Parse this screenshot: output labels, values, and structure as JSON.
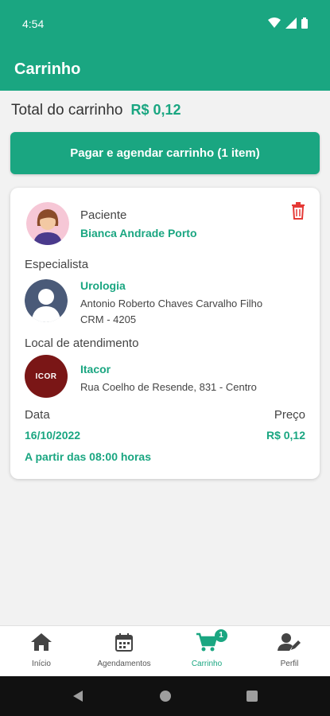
{
  "status_bar": {
    "time": "4:54"
  },
  "app_bar": {
    "title": "Carrinho"
  },
  "summary": {
    "label": "Total do carrinho",
    "value": "R$ 0,12"
  },
  "pay_button": {
    "label": "Pagar e agendar carrinho (1 item)"
  },
  "cart_item": {
    "patient_label": "Paciente",
    "patient_name": "Bianca Andrade Porto",
    "specialist_label": "Especialista",
    "specialty": "Urologia",
    "doctor_name": "Antonio Roberto Chaves Carvalho Filho",
    "doctor_crm": "CRM - 4205",
    "location_label": "Local de atendimento",
    "clinic_name": "Itacor",
    "clinic_address": "Rua Coelho de Resende, 831 - Centro",
    "date_label": "Data",
    "price_label": "Preço",
    "date": "16/10/2022",
    "price": "R$ 0,12",
    "time_note": "A partir das 08:00 horas",
    "clinic_logo_text": "ICOR"
  },
  "bottom_nav": {
    "items": [
      {
        "label": "Início",
        "icon": "home-icon"
      },
      {
        "label": "Agendamentos",
        "icon": "calendar-icon"
      },
      {
        "label": "Carrinho",
        "icon": "cart-icon",
        "badge": "1",
        "active": true
      },
      {
        "label": "Perfil",
        "icon": "profile-edit-icon"
      }
    ]
  },
  "colors": {
    "primary": "#1aa681",
    "delete": "#e53935"
  }
}
